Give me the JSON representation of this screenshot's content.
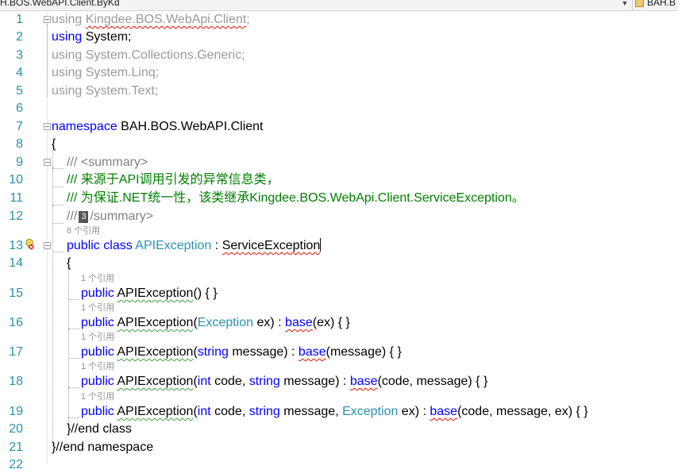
{
  "nav_bar": {
    "left": "H.BOS.WebAPI.Client.ByKd",
    "arrow": "▼",
    "right": "BAH.B"
  },
  "code": {
    "line1": {
      "num": "1",
      "kw": "using",
      "ns": "Kingdee.BOS.WebApi.Client",
      "end": ";"
    },
    "line2": {
      "num": "2",
      "kw": "using",
      "ns": "System",
      "end": ";"
    },
    "line3": {
      "num": "3",
      "kw": "using",
      "ns": "System.Collections.Generic",
      "end": ";"
    },
    "line4": {
      "num": "4",
      "kw": "using",
      "ns": "System.Linq",
      "end": ";"
    },
    "line5": {
      "num": "5",
      "kw": "using",
      "ns": "System.Text",
      "end": ";"
    },
    "line6": {
      "num": "6"
    },
    "line7": {
      "num": "7",
      "kw": "namespace",
      "name": "BAH.BOS.WebAPI.Client"
    },
    "line8": {
      "num": "8",
      "text": "{"
    },
    "line9": {
      "num": "9",
      "slashes": "///",
      "tag": "<summary>"
    },
    "line10": {
      "num": "10",
      "text": "/// 来源于API调用引发的异常信息类，"
    },
    "line11": {
      "num": "11",
      "text": "/// 为保证.NET统一性，该类继承Kingdee.BOS.WebApi.Client.ServiceException。"
    },
    "line12": {
      "num": "12",
      "slashes": "///",
      "badge": "3",
      "tag": "/summary>"
    },
    "lens13": "8 个引用",
    "line13": {
      "num": "13",
      "kw1": "public",
      "kw2": "class",
      "type": "APIException",
      "colon": ":",
      "base": "ServiceException"
    },
    "line14": {
      "num": "14",
      "text": "{"
    },
    "lens15": "1 个引用",
    "line15": {
      "num": "15",
      "kw": "public",
      "name": "APIException",
      "rest": "() { }"
    },
    "lens16": "1 个引用",
    "line16": {
      "num": "16",
      "kw": "public",
      "name": "APIException",
      "p1": "(",
      "type": "Exception",
      "p2": " ex) : ",
      "base": "base",
      "p3": "(ex) { }"
    },
    "lens17": "1 个引用",
    "line17": {
      "num": "17",
      "kw": "public",
      "name": "APIException",
      "p1": "(",
      "type": "string",
      "p2": " message) : ",
      "base": "base",
      "p3": "(message) { }"
    },
    "lens18": "1 个引用",
    "line18": {
      "num": "18",
      "kw": "public",
      "name": "APIException",
      "p1": "(",
      "t1": "int",
      "p2": " code, ",
      "t2": "string",
      "p3": " message) : ",
      "base": "base",
      "p4": "(code, message) { }"
    },
    "lens19": "1 个引用",
    "line19": {
      "num": "19",
      "kw": "public",
      "name": "APIException",
      "p1": "(",
      "t1": "int",
      "p2": " code, ",
      "t2": "string",
      "p3": " message, ",
      "t3": "Exception",
      "p4": " ex) : ",
      "base": "base",
      "p5": "(code, message, ex) { }"
    },
    "line20": {
      "num": "20",
      "text": "}//end class"
    },
    "line21": {
      "num": "21",
      "text": "}//end namespace"
    },
    "line22": {
      "num": "22"
    }
  }
}
